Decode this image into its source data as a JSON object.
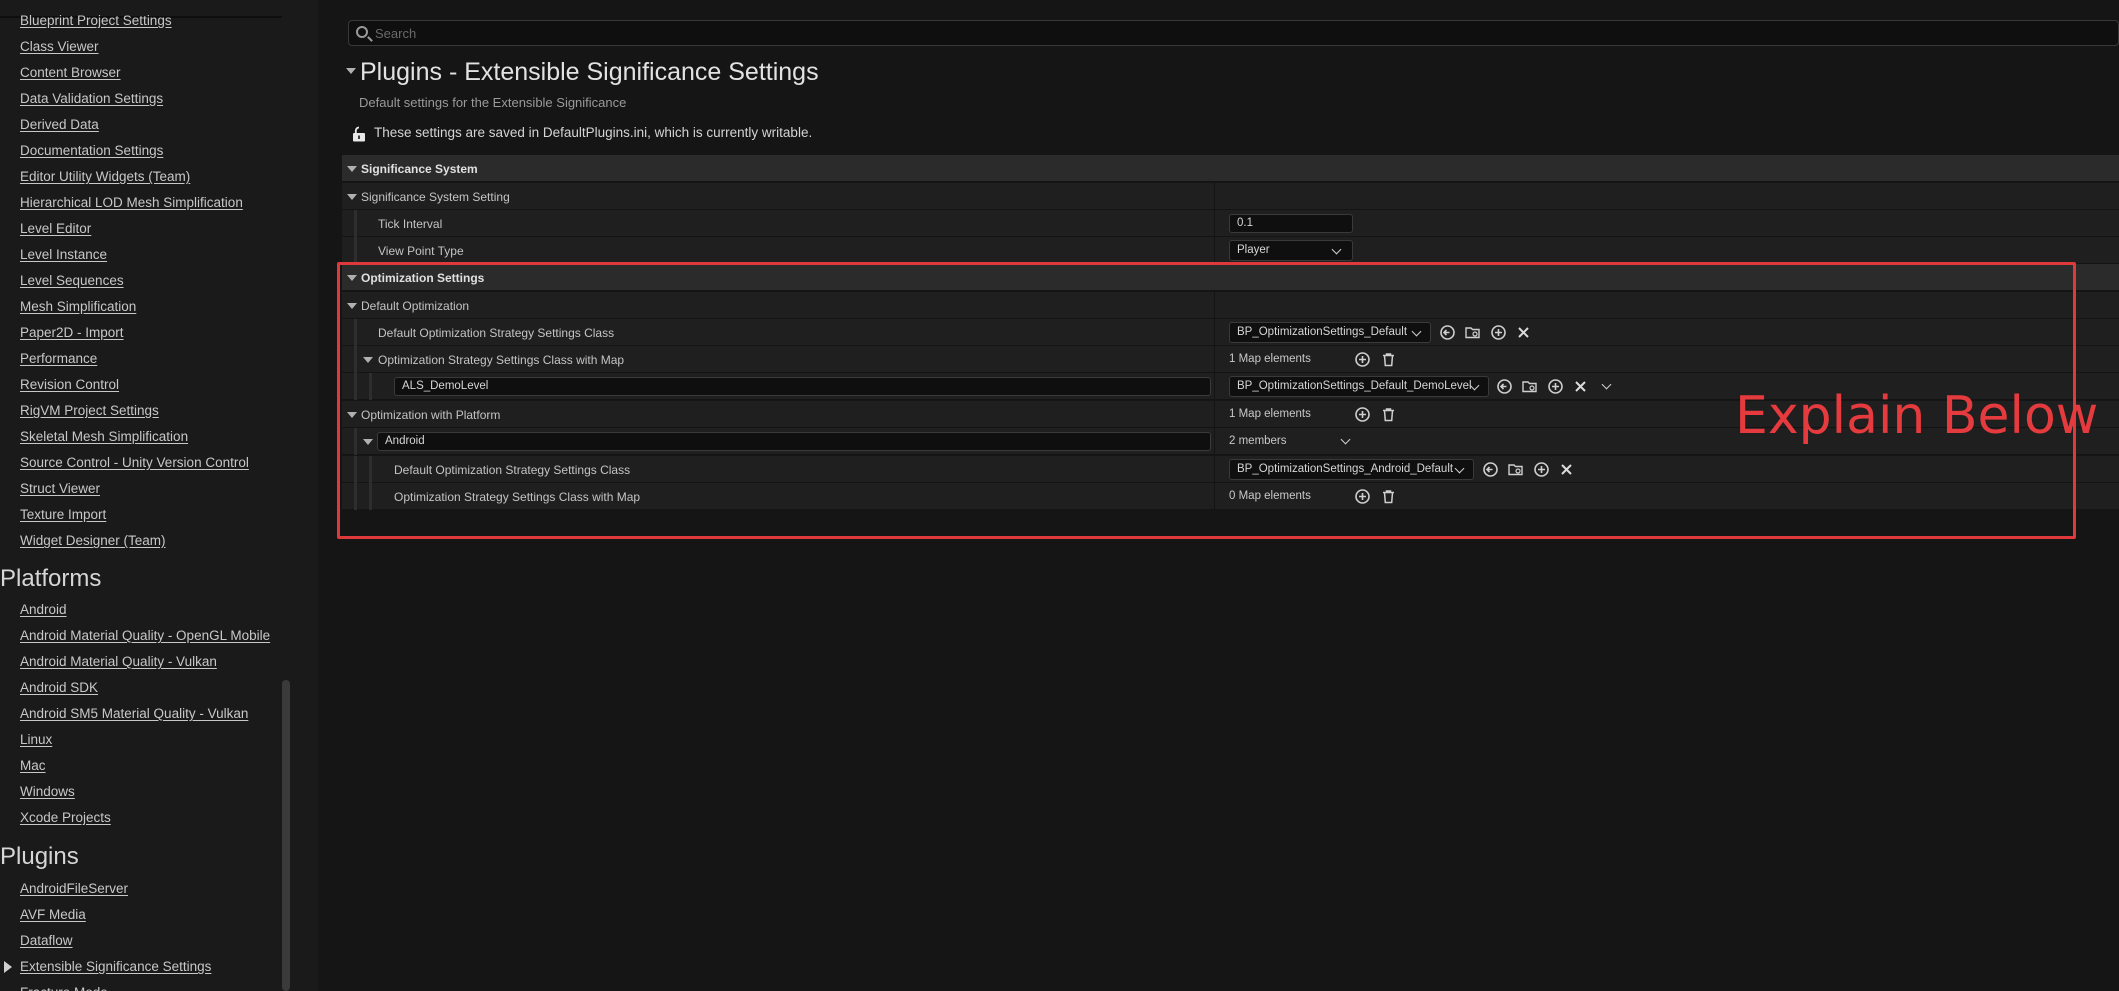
{
  "sidebar": {
    "items_top": [
      "Blueprint Project Settings",
      "Class Viewer",
      "Content Browser",
      "Data Validation Settings",
      "Derived Data",
      "Documentation Settings",
      "Editor Utility Widgets (Team)",
      "Hierarchical LOD Mesh Simplification",
      "Level Editor",
      "Level Instance",
      "Level Sequences",
      "Mesh Simplification",
      "Paper2D - Import",
      "Performance",
      "Revision Control",
      "RigVM Project Settings",
      "Skeletal Mesh Simplification",
      "Source Control - Unity Version Control",
      "Struct Viewer",
      "Texture Import",
      "Widget Designer (Team)"
    ],
    "platforms_heading": "Platforms",
    "platforms": [
      "Android",
      "Android Material Quality - OpenGL Mobile",
      "Android Material Quality - Vulkan",
      "Android SDK",
      "Android SM5 Material Quality - Vulkan",
      "Linux",
      "Mac",
      "Windows",
      "Xcode Projects"
    ],
    "plugins_heading": "Plugins",
    "plugins": [
      "AndroidFileServer",
      "AVF Media",
      "Dataflow",
      "Extensible Significance Settings",
      "Fracture Mode"
    ],
    "selected": "Extensible Significance Settings"
  },
  "search": {
    "placeholder": "Search",
    "value": ""
  },
  "header": {
    "title": "Plugins - Extensible Significance Settings",
    "subtitle": "Default settings for the Extensible Significance",
    "save_note": "These settings are saved in DefaultPlugins.ini, which is currently writable."
  },
  "grid": {
    "significance_system": {
      "label": "Significance System",
      "setting_label": "Significance System Setting",
      "tick_interval_label": "Tick Interval",
      "tick_interval_value": "0.1",
      "view_point_type_label": "View Point Type",
      "view_point_type_value": "Player"
    },
    "optimization_settings": {
      "label": "Optimization Settings",
      "default_optimization_label": "Default Optimization",
      "default_class_label": "Default Optimization Strategy Settings Class",
      "default_class_value": "BP_OptimizationSettings_Default",
      "class_with_map_label": "Optimization Strategy Settings Class with Map",
      "class_with_map_count": "1 Map elements",
      "map_key": "ALS_DemoLevel",
      "map_value": "BP_OptimizationSettings_Default_DemoLevel",
      "with_platform_label": "Optimization with Platform",
      "with_platform_count": "1 Map elements",
      "platform_key": "Android",
      "platform_members": "2 members",
      "platform_default_class_label": "Default Optimization Strategy Settings Class",
      "platform_default_class_value": "BP_OptimizationSettings_Android_Default",
      "platform_class_with_map_label": "Optimization Strategy Settings Class with Map",
      "platform_class_with_map_count": "0 Map elements"
    }
  },
  "annotation": {
    "text": "Explain Below",
    "color": "#e63b3e"
  },
  "colors": {
    "background": "#151515",
    "category_row": "#2b2b2b",
    "row": "#1f1f1f",
    "annotation": "#e0393c"
  }
}
